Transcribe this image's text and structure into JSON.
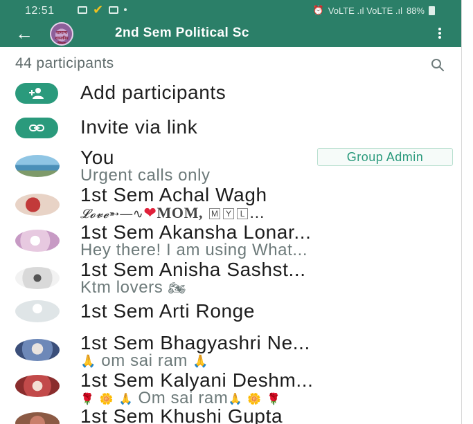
{
  "status_bar": {
    "time": "12:51",
    "network_text": "VoLTE .ıl VoLTE .ıl",
    "battery": "88%"
  },
  "app_bar": {
    "title": "2nd Sem Political Sc",
    "avatar_text": "सामान्य\nशासकीय शिक्षा",
    "back_icon": "arrow-left-icon",
    "menu_icon": "more-vert-icon"
  },
  "participants_header": {
    "count_label": "44 participants",
    "search_icon": "search-icon"
  },
  "actions": [
    {
      "label": "Add participants",
      "icon": "add-person-icon"
    },
    {
      "label": "Invite via link",
      "icon": "link-icon"
    }
  ],
  "participants": [
    {
      "name": "You",
      "status": "Urgent calls only",
      "badge": "Group Admin"
    },
    {
      "name": "1st Sem Achal Wagh",
      "status_parts": [
        "𝓛𝓸𝓿𝓮",
        "➵—∿",
        "❤",
        "MOM,",
        "M",
        "Y",
        "L",
        "..."
      ]
    },
    {
      "name": "1st Sem Akansha Lonar...",
      "status": "Hey there! I am using What..."
    },
    {
      "name": "1st Sem Anisha Sashst...",
      "status": "Ktm lovers",
      "status_emoji": "🏍"
    },
    {
      "name": "1st Sem Arti Ronge",
      "status": ""
    },
    {
      "name": "1st Sem Bhagyashri Ne...",
      "status": "om sai ram",
      "status_emoji": "🙏"
    },
    {
      "name": "1st Sem Kalyani Deshm...",
      "status": "Om sai ram",
      "status_emojis": [
        "🌹",
        "🌼",
        "🙏"
      ]
    },
    {
      "name": "1st Sem Khushi Gupta",
      "status": ""
    }
  ],
  "colors": {
    "header": "#2b7f68",
    "accent": "#2a9a7c",
    "secondary_text": "#6d7a7a"
  }
}
